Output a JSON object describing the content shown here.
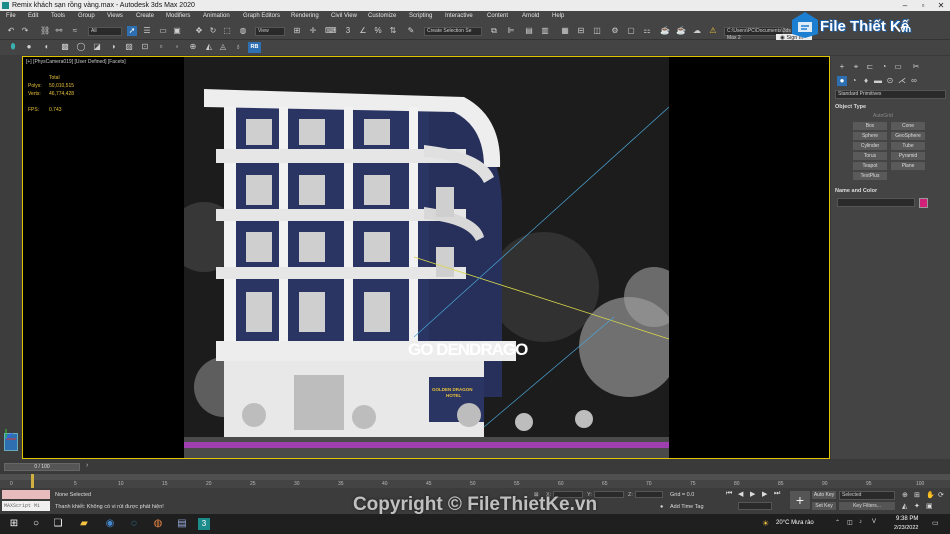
{
  "window": {
    "title": "Remix khách sạn rồng vàng.max - Autodesk 3ds Max 2020"
  },
  "menu": [
    "File",
    "Edit",
    "Tools",
    "Group",
    "Views",
    "Create",
    "Modifiers",
    "Animation",
    "Graph Editors",
    "Rendering",
    "Civil View",
    "Customize",
    "Scripting",
    "Interactive",
    "Content",
    "Arnold",
    "Help"
  ],
  "toolbar": {
    "all_filter": "All",
    "view_dropdown": "View",
    "selection_set": "Create Selection Se",
    "path": "C:\\Users\\PC\\Documents\\3ds Max 2",
    "sign_in": "Sign In",
    "rb_badge": "RB"
  },
  "viewport": {
    "label": "[+] [PhysCamera019] [User Defined] [Facets]",
    "total_label": "Total",
    "polys_label": "Polys:",
    "polys_value": "50,010,515",
    "verts_label": "Verts:",
    "verts_value": "46,774,428",
    "fps_label": "FPS:",
    "fps_value": "0.743",
    "sign_text": "GO DENDRAGO",
    "hotel_sign_1": "GOLDEN DRAGON",
    "hotel_sign_2": "HOTEL"
  },
  "command_panel": {
    "category": "Standard Primitives",
    "object_type_header": "Object Type",
    "autogrid": "AutoGrid",
    "buttons": [
      "Box",
      "Cone",
      "Sphere",
      "GeoSphere",
      "Cylinder",
      "Tube",
      "Torus",
      "Pyramid",
      "Teapot",
      "Plane",
      "TextPlus"
    ],
    "name_color_header": "Name and Color",
    "color": "#d0207a"
  },
  "timeline": {
    "frame_display": "0 / 100",
    "ticks": [
      "0",
      "5",
      "10",
      "15",
      "20",
      "25",
      "30",
      "35",
      "40",
      "45",
      "50",
      "55",
      "60",
      "65",
      "70",
      "75",
      "80",
      "85",
      "90",
      "95",
      "100"
    ]
  },
  "status": {
    "selection": "None Selected",
    "message": "Thanh khiết: Không có vi rút được phát hiện!",
    "script_label": "MAXScript Mi",
    "x_label": "X:",
    "y_label": "Y:",
    "z_label": "Z:",
    "grid": "Grid = 0.0",
    "add_time_tag": "Add Time Tag",
    "auto_key": "Auto Key",
    "set_key": "Set Key",
    "selected": "Selected",
    "key_filters": "Key Filters..."
  },
  "taskbar": {
    "weather": "20°C  Mưa rào",
    "time": "9:38 PM",
    "date": "2/23/2022"
  },
  "brand": {
    "name": "File Thiết Kế",
    "suffix": ".vn"
  },
  "watermark": "Copyright © FileThietKe.vn"
}
